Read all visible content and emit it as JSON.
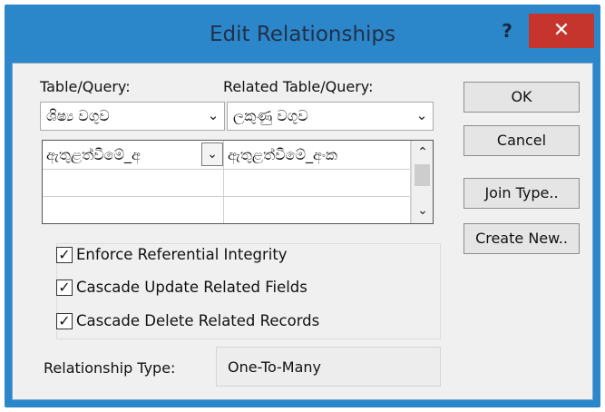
{
  "dialog": {
    "title": "Edit Relationships",
    "help_label": "?",
    "close_label": "✕"
  },
  "table_query": {
    "label": "Table/Query:",
    "value": "ශිෂ්‍ය වගුව"
  },
  "related_table_query": {
    "label": "Related Table/Query:",
    "value": "ලකුණු වගුව"
  },
  "fields_grid": {
    "rows": [
      {
        "left": "ඇතුළත්වීමේ_අ",
        "right": "ඇතුළත්වීමේ_අංක"
      },
      {
        "left": "",
        "right": ""
      },
      {
        "left": "",
        "right": ""
      }
    ]
  },
  "options": {
    "enforce_integrity": {
      "label": "Enforce Referential Integrity",
      "checked": true
    },
    "cascade_update": {
      "label": "Cascade Update Related Fields",
      "checked": true
    },
    "cascade_delete": {
      "label": "Cascade Delete Related Records",
      "checked": true
    }
  },
  "buttons": {
    "ok": "OK",
    "cancel": "Cancel",
    "join_type": "Join Type..",
    "create_new": "Create New.."
  },
  "relationship_type": {
    "label": "Relationship Type:",
    "value": "One-To-Many"
  },
  "icons": {
    "dropdown": "chevron-down-icon",
    "scroll_up": "chevron-up-icon",
    "checkmark": "check-icon"
  },
  "colors": {
    "frame": "#2b87c9",
    "close_button": "#c5352d",
    "client_bg": "#f0f0f0"
  }
}
